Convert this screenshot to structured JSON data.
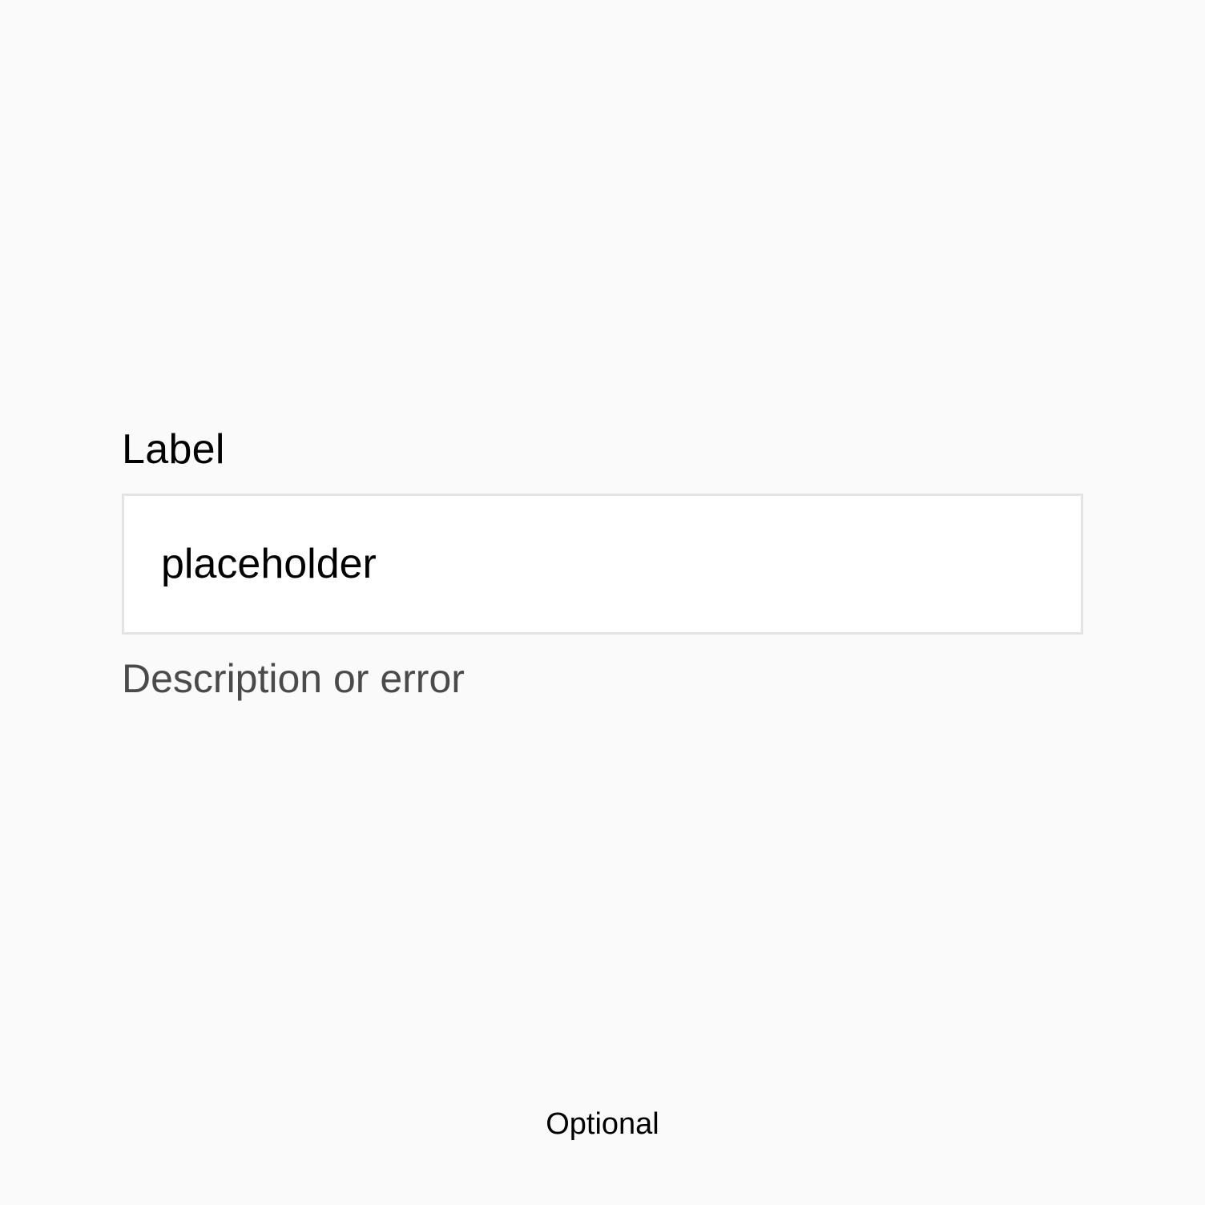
{
  "field": {
    "label": "Label",
    "placeholder": "placeholder",
    "value": "",
    "description": "Description or error"
  },
  "footer": {
    "optional": "Optional"
  },
  "colors": {
    "background": "#fafafa",
    "input_background": "#ffffff",
    "input_border": "#e3e3e3",
    "label_text": "#000000",
    "description_text": "#4a4a4a"
  }
}
